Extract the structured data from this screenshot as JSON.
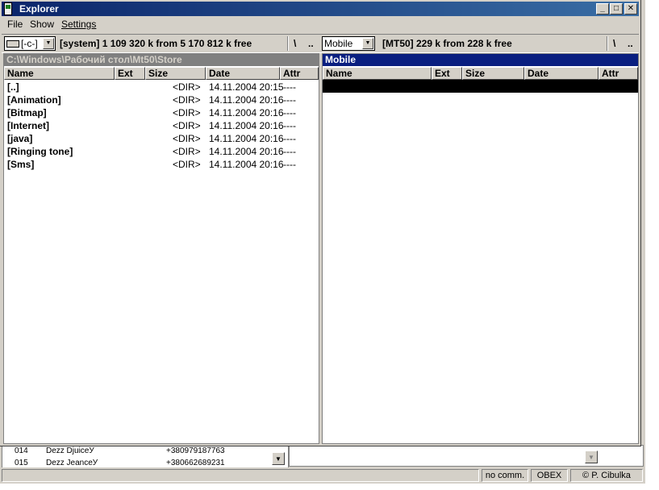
{
  "window": {
    "title": "Explorer"
  },
  "menu": {
    "file": "File",
    "show": "Show",
    "settings": "Settings"
  },
  "left_panel": {
    "drive": "[-c-]",
    "drive_info": "[system]  1 109 320 k from 5 170 812 k free",
    "root_button": "\\",
    "up_button": "..",
    "path": "C:\\Windows\\Рабочий стол\\Mt50\\Store",
    "columns": [
      "Name",
      "Ext",
      "Size",
      "Date",
      "Attr"
    ],
    "rows": [
      {
        "name": "[..]",
        "size": "<DIR>",
        "date": "14.11.2004 20:15",
        "attr": "----"
      },
      {
        "name": "[Animation]",
        "size": "<DIR>",
        "date": "14.11.2004 20:16",
        "attr": "----"
      },
      {
        "name": "[Bitmap]",
        "size": "<DIR>",
        "date": "14.11.2004 20:16",
        "attr": "----"
      },
      {
        "name": "[Internet]",
        "size": "<DIR>",
        "date": "14.11.2004 20:16",
        "attr": "----"
      },
      {
        "name": "[java]",
        "size": "<DIR>",
        "date": "14.11.2004 20:16",
        "attr": "----"
      },
      {
        "name": "[Ringing tone]",
        "size": "<DIR>",
        "date": "14.11.2004 20:16",
        "attr": "----"
      },
      {
        "name": "[Sms]",
        "size": "<DIR>",
        "date": "14.11.2004 20:16",
        "attr": "----"
      }
    ]
  },
  "right_panel": {
    "drive": "Mobile",
    "drive_info": "[MT50]  229 k from 228 k free",
    "root_button": "\\",
    "up_button": "..",
    "path": "Mobile",
    "columns": [
      "Name",
      "Ext",
      "Size",
      "Date",
      "Attr"
    ]
  },
  "background_list": {
    "rows": [
      {
        "id": "014",
        "name": "Dezz DjuiceУ",
        "phone": "+380979187763"
      },
      {
        "id": "015",
        "name": "Dezz JeanceУ",
        "phone": "+380662689231"
      }
    ]
  },
  "statusbar": {
    "connection": "no comm.",
    "protocol": "OBEX",
    "copyright": "© P. Cibulka"
  }
}
